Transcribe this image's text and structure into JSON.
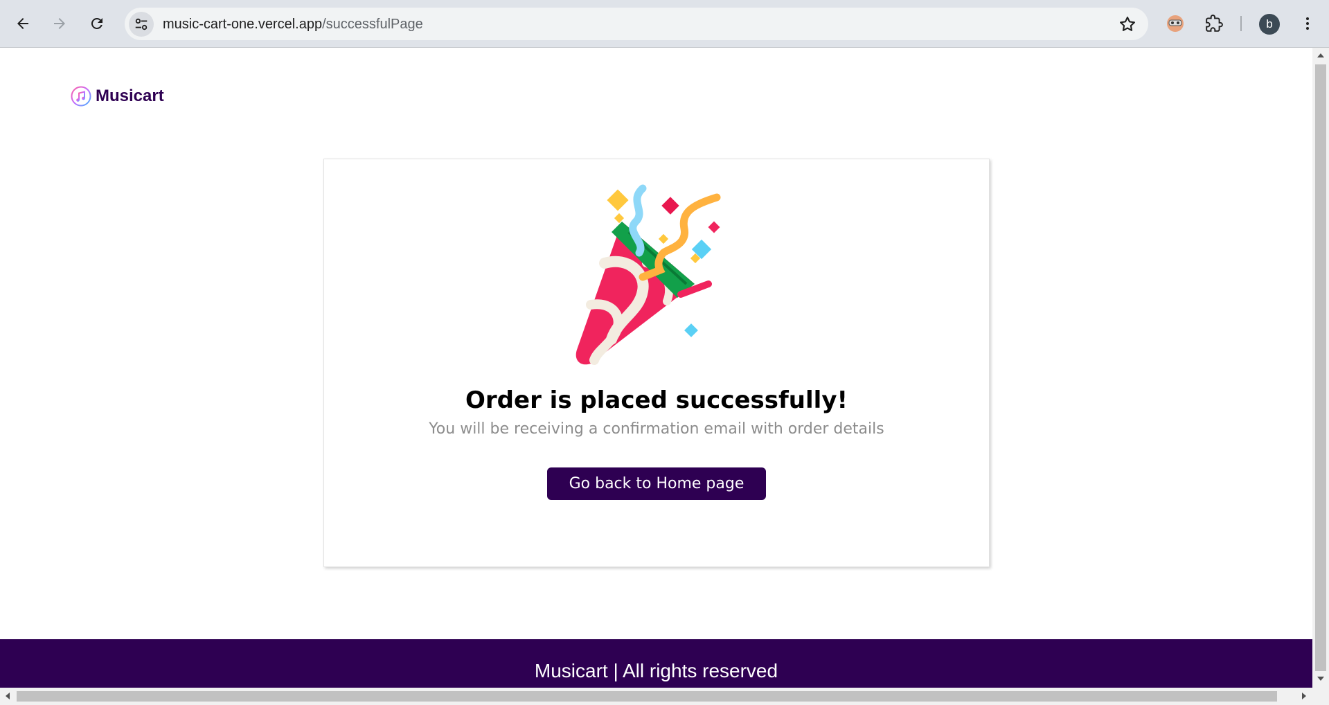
{
  "browser": {
    "url_host": "music-cart-one.vercel.app",
    "url_path": "/successfulPage",
    "profile_initial": "b"
  },
  "site": {
    "logo_text": "Musicart"
  },
  "success": {
    "title": "Order is placed successfully!",
    "subtitle": "You will be receiving a confirmation email with order details",
    "button_label": "Go back to Home page"
  },
  "footer": {
    "text": "Musicart | All rights reserved"
  },
  "colors": {
    "brand": "#2e0052",
    "chrome": "#dfe3e9"
  }
}
